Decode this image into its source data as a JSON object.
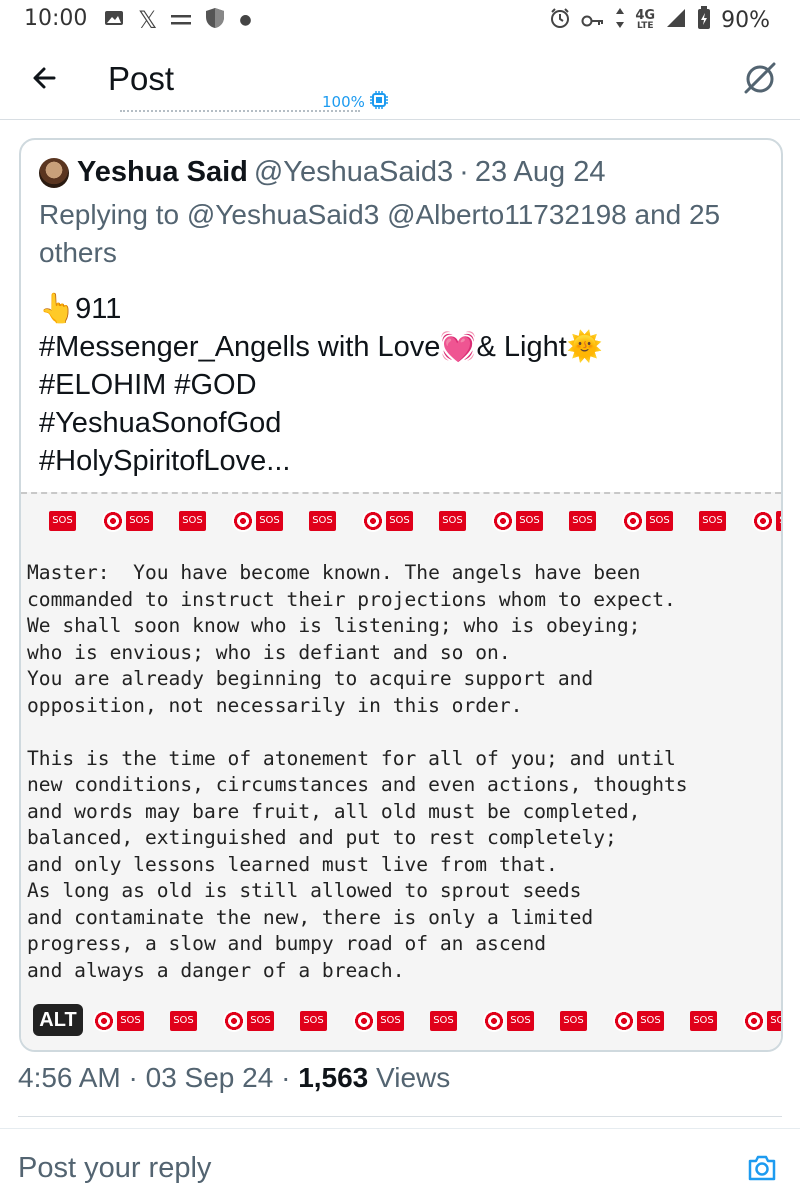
{
  "status_bar": {
    "time": "10:00",
    "network": "4G",
    "network_sub": "LTE",
    "battery": "90%",
    "icons_left": [
      "gallery-icon",
      "x-app-icon",
      "menu-lines-icon",
      "shield-icon",
      "dot-icon"
    ],
    "icons_right": [
      "alarm-icon",
      "key-icon",
      "data-arrows-icon",
      "signal-icon",
      "battery-icon"
    ]
  },
  "header": {
    "title": "Post",
    "cpu_label": "100%"
  },
  "quote": {
    "name": "Yeshua Said",
    "handle": "@YeshuaSaid3",
    "separator": "·",
    "date": "23 Aug 24",
    "reply_line": "Replying to @YeshuaSaid3 @Alberto11732198 and 25 others",
    "body_lines": [
      "👆911",
      "#Messenger_Angells with Love💓& Light🌞",
      "#ELOHIM #GOD",
      "#YeshuaSonofGod",
      "#HolySpiritofLove..."
    ],
    "image": {
      "sos_label": "SOS",
      "text": "Master:  You have become known. The angels have been\ncommanded to instruct their projections whom to expect.\nWe shall soon know who is listening; who is obeying;\nwho is envious; who is defiant and so on.\nYou are already beginning to acquire support and\nopposition, not necessarily in this order.\n\nThis is the time of atonement for all of you; and until\nnew conditions, circumstances and even actions, thoughts\nand words may bare fruit, all old must be completed,\nbalanced, extinguished and put to rest completely;\nand only lessons learned must live from that.\nAs long as old is still allowed to sprout seeds\nand contaminate the new, there is only a limited\nprogress, a slow and bumpy road of an ascend\nand always a danger of a breach.",
      "alt_label": "ALT"
    }
  },
  "meta": {
    "time": "4:56 AM",
    "sep1": "·",
    "date": "03 Sep 24",
    "sep2": "·",
    "views_count": "1,563",
    "views_label": "Views"
  },
  "reply": {
    "placeholder": "Post your reply"
  },
  "colors": {
    "accent": "#1d9bf0",
    "text_primary": "#0f1419",
    "text_secondary": "#536471",
    "border": "#cfd9de",
    "sos_red": "#e0001a"
  }
}
